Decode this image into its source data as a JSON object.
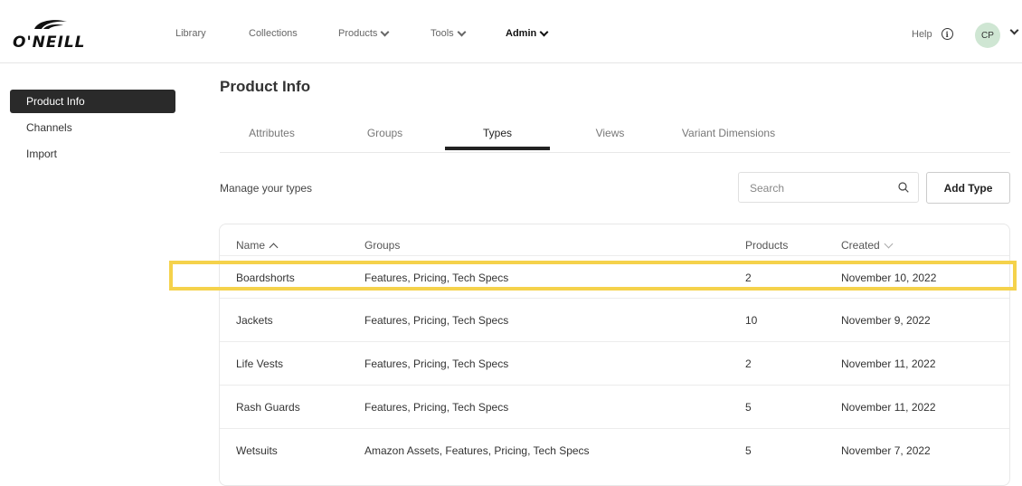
{
  "brand": {
    "name": "O'NEILL"
  },
  "nav": {
    "items": [
      {
        "label": "Library",
        "dropdown": false
      },
      {
        "label": "Collections",
        "dropdown": false
      },
      {
        "label": "Products",
        "dropdown": true
      },
      {
        "label": "Tools",
        "dropdown": true
      },
      {
        "label": "Admin",
        "dropdown": true,
        "active": true
      }
    ],
    "help": "Help",
    "avatar": "CP"
  },
  "sidebar": {
    "items": [
      {
        "label": "Product Info",
        "active": true
      },
      {
        "label": "Channels"
      },
      {
        "label": "Import"
      }
    ]
  },
  "page": {
    "title": "Product Info",
    "tabs": [
      {
        "label": "Attributes"
      },
      {
        "label": "Groups"
      },
      {
        "label": "Types",
        "active": true
      },
      {
        "label": "Views"
      },
      {
        "label": "Variant Dimensions"
      }
    ],
    "subtitle": "Manage your types",
    "search_placeholder": "Search",
    "add_button": "Add Type"
  },
  "table": {
    "columns": [
      "Name",
      "Groups",
      "Products",
      "Created"
    ],
    "sort": {
      "column": "Name",
      "direction": "asc"
    },
    "rows": [
      {
        "name": "Boardshorts",
        "groups": "Features, Pricing, Tech Specs",
        "products": "2",
        "created": "November 10, 2022",
        "highlighted": true
      },
      {
        "name": "Jackets",
        "groups": "Features, Pricing, Tech Specs",
        "products": "10",
        "created": "November 9, 2022"
      },
      {
        "name": "Life Vests",
        "groups": "Features, Pricing, Tech Specs",
        "products": "2",
        "created": "November 11, 2022"
      },
      {
        "name": "Rash Guards",
        "groups": "Features, Pricing, Tech Specs",
        "products": "5",
        "created": "November 11, 2022"
      },
      {
        "name": "Wetsuits",
        "groups": "Amazon Assets, Features, Pricing, Tech Specs",
        "products": "5",
        "created": "November 7, 2022"
      }
    ]
  },
  "colors": {
    "highlight": "#f5d24b",
    "active_bg": "#2a2a2a",
    "avatar_bg": "#cfe6d3"
  }
}
